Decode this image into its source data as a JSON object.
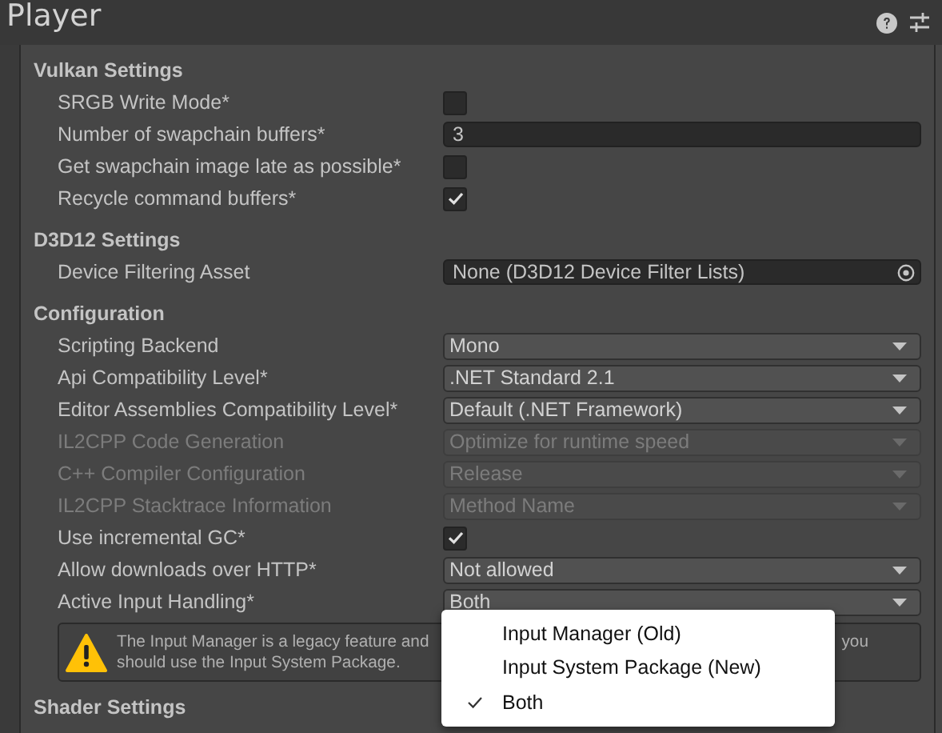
{
  "title": "Player",
  "sections": [
    {
      "heading": "Vulkan Settings",
      "rows": [
        {
          "label": "SRGB Write Mode*",
          "kind": "checkbox",
          "checked": false
        },
        {
          "label": "Number of swapchain buffers*",
          "kind": "text",
          "value": "3",
          "disabled": false
        },
        {
          "label": "Get swapchain image late as possible*",
          "kind": "checkbox",
          "checked": false
        },
        {
          "label": "Recycle command buffers*",
          "kind": "checkbox",
          "checked": true
        }
      ]
    },
    {
      "heading": "D3D12 Settings",
      "rows": [
        {
          "label": "Device Filtering Asset",
          "kind": "object",
          "value": "None (D3D12 Device Filter Lists)",
          "disabled": false
        }
      ]
    },
    {
      "heading": "Configuration",
      "rows": [
        {
          "label": "Scripting Backend",
          "kind": "dropdown",
          "value": "Mono",
          "disabled": false
        },
        {
          "label": "Api Compatibility Level*",
          "kind": "dropdown",
          "value": ".NET Standard 2.1",
          "disabled": false
        },
        {
          "label": "Editor Assemblies Compatibility Level*",
          "kind": "dropdown",
          "value": "Default (.NET Framework)",
          "disabled": false
        },
        {
          "label": "IL2CPP Code Generation",
          "kind": "dropdown",
          "value": "Optimize for runtime speed",
          "disabled": true
        },
        {
          "label": "C++ Compiler Configuration",
          "kind": "dropdown",
          "value": "Release",
          "disabled": true
        },
        {
          "label": "IL2CPP Stacktrace Information",
          "kind": "dropdown",
          "value": "Method Name",
          "disabled": true
        },
        {
          "label": "Use incremental GC*",
          "kind": "checkbox",
          "checked": true
        },
        {
          "label": "Allow downloads over HTTP*",
          "kind": "dropdown",
          "value": "Not allowed",
          "disabled": false
        },
        {
          "label": "Active Input Handling*",
          "kind": "dropdown",
          "value": "Both",
          "disabled": false
        }
      ],
      "warning": {
        "line_1": "The Input Manager is a legacy feature and",
        "line_1_end": "you",
        "line_2": "should use the Input System Package."
      }
    },
    {
      "heading": "Shader Settings"
    }
  ],
  "popup": [
    {
      "label": "Input Manager (Old)",
      "selected": false
    },
    {
      "label": "Input System Package (New)",
      "selected": false
    },
    {
      "label": "Both",
      "selected": true
    }
  ]
}
